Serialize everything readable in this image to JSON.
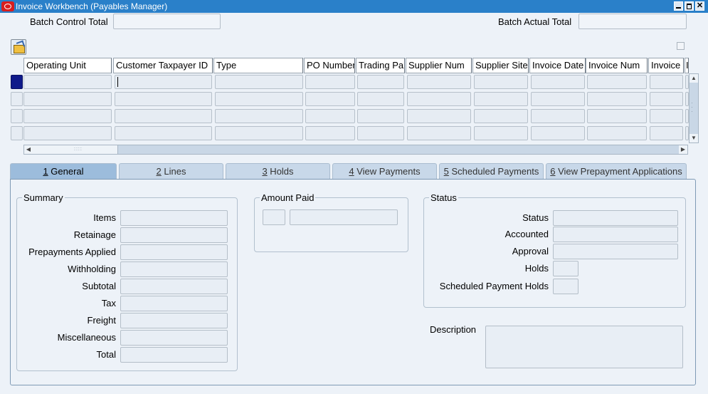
{
  "window": {
    "title": "Invoice Workbench (Payables Manager)",
    "min": "",
    "max": "",
    "close": "✕"
  },
  "header": {
    "batch_control_total_label": "Batch Control Total",
    "batch_control_total_value": "",
    "batch_actual_total_label": "Batch Actual Total",
    "batch_actual_total_value": ""
  },
  "grid": {
    "columns": [
      "Operating Unit",
      "Customer Taxpayer ID",
      "Type",
      "PO Number",
      "Trading Pa",
      "Supplier Num",
      "Supplier Site",
      "Invoice Date",
      "Invoice Num",
      "Invoice",
      "I"
    ]
  },
  "tabs": [
    {
      "num": "1",
      "label": " General"
    },
    {
      "num": "2",
      "label": " Lines"
    },
    {
      "num": "3",
      "label": " Holds"
    },
    {
      "num": "4",
      "label": " View Payments"
    },
    {
      "num": "5",
      "label": " Scheduled Payments"
    },
    {
      "num": "6",
      "label": " View Prepayment Applications"
    }
  ],
  "summary": {
    "title": "Summary",
    "fields": [
      "Items",
      "Retainage",
      "Prepayments Applied",
      "Withholding",
      "Subtotal",
      "Tax",
      "Freight",
      "Miscellaneous",
      "Total"
    ]
  },
  "amount_paid": {
    "title": "Amount Paid"
  },
  "status": {
    "title": "Status",
    "fields": [
      "Status",
      "Accounted",
      "Approval",
      "Holds",
      "Scheduled Payment Holds"
    ]
  },
  "description": {
    "label": "Description"
  }
}
